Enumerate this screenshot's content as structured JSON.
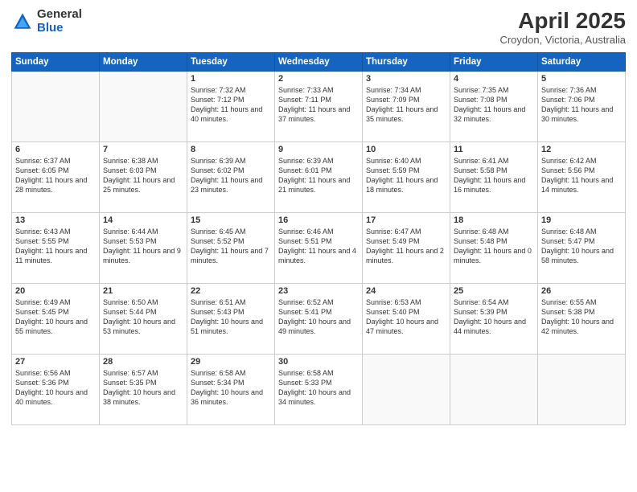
{
  "logo": {
    "general": "General",
    "blue": "Blue"
  },
  "title": {
    "month": "April 2025",
    "location": "Croydon, Victoria, Australia"
  },
  "weekdays": [
    "Sunday",
    "Monday",
    "Tuesday",
    "Wednesday",
    "Thursday",
    "Friday",
    "Saturday"
  ],
  "weeks": [
    [
      {
        "day": "",
        "info": ""
      },
      {
        "day": "",
        "info": ""
      },
      {
        "day": "1",
        "info": "Sunrise: 7:32 AM\nSunset: 7:12 PM\nDaylight: 11 hours and 40 minutes."
      },
      {
        "day": "2",
        "info": "Sunrise: 7:33 AM\nSunset: 7:11 PM\nDaylight: 11 hours and 37 minutes."
      },
      {
        "day": "3",
        "info": "Sunrise: 7:34 AM\nSunset: 7:09 PM\nDaylight: 11 hours and 35 minutes."
      },
      {
        "day": "4",
        "info": "Sunrise: 7:35 AM\nSunset: 7:08 PM\nDaylight: 11 hours and 32 minutes."
      },
      {
        "day": "5",
        "info": "Sunrise: 7:36 AM\nSunset: 7:06 PM\nDaylight: 11 hours and 30 minutes."
      }
    ],
    [
      {
        "day": "6",
        "info": "Sunrise: 6:37 AM\nSunset: 6:05 PM\nDaylight: 11 hours and 28 minutes."
      },
      {
        "day": "7",
        "info": "Sunrise: 6:38 AM\nSunset: 6:03 PM\nDaylight: 11 hours and 25 minutes."
      },
      {
        "day": "8",
        "info": "Sunrise: 6:39 AM\nSunset: 6:02 PM\nDaylight: 11 hours and 23 minutes."
      },
      {
        "day": "9",
        "info": "Sunrise: 6:39 AM\nSunset: 6:01 PM\nDaylight: 11 hours and 21 minutes."
      },
      {
        "day": "10",
        "info": "Sunrise: 6:40 AM\nSunset: 5:59 PM\nDaylight: 11 hours and 18 minutes."
      },
      {
        "day": "11",
        "info": "Sunrise: 6:41 AM\nSunset: 5:58 PM\nDaylight: 11 hours and 16 minutes."
      },
      {
        "day": "12",
        "info": "Sunrise: 6:42 AM\nSunset: 5:56 PM\nDaylight: 11 hours and 14 minutes."
      }
    ],
    [
      {
        "day": "13",
        "info": "Sunrise: 6:43 AM\nSunset: 5:55 PM\nDaylight: 11 hours and 11 minutes."
      },
      {
        "day": "14",
        "info": "Sunrise: 6:44 AM\nSunset: 5:53 PM\nDaylight: 11 hours and 9 minutes."
      },
      {
        "day": "15",
        "info": "Sunrise: 6:45 AM\nSunset: 5:52 PM\nDaylight: 11 hours and 7 minutes."
      },
      {
        "day": "16",
        "info": "Sunrise: 6:46 AM\nSunset: 5:51 PM\nDaylight: 11 hours and 4 minutes."
      },
      {
        "day": "17",
        "info": "Sunrise: 6:47 AM\nSunset: 5:49 PM\nDaylight: 11 hours and 2 minutes."
      },
      {
        "day": "18",
        "info": "Sunrise: 6:48 AM\nSunset: 5:48 PM\nDaylight: 11 hours and 0 minutes."
      },
      {
        "day": "19",
        "info": "Sunrise: 6:48 AM\nSunset: 5:47 PM\nDaylight: 10 hours and 58 minutes."
      }
    ],
    [
      {
        "day": "20",
        "info": "Sunrise: 6:49 AM\nSunset: 5:45 PM\nDaylight: 10 hours and 55 minutes."
      },
      {
        "day": "21",
        "info": "Sunrise: 6:50 AM\nSunset: 5:44 PM\nDaylight: 10 hours and 53 minutes."
      },
      {
        "day": "22",
        "info": "Sunrise: 6:51 AM\nSunset: 5:43 PM\nDaylight: 10 hours and 51 minutes."
      },
      {
        "day": "23",
        "info": "Sunrise: 6:52 AM\nSunset: 5:41 PM\nDaylight: 10 hours and 49 minutes."
      },
      {
        "day": "24",
        "info": "Sunrise: 6:53 AM\nSunset: 5:40 PM\nDaylight: 10 hours and 47 minutes."
      },
      {
        "day": "25",
        "info": "Sunrise: 6:54 AM\nSunset: 5:39 PM\nDaylight: 10 hours and 44 minutes."
      },
      {
        "day": "26",
        "info": "Sunrise: 6:55 AM\nSunset: 5:38 PM\nDaylight: 10 hours and 42 minutes."
      }
    ],
    [
      {
        "day": "27",
        "info": "Sunrise: 6:56 AM\nSunset: 5:36 PM\nDaylight: 10 hours and 40 minutes."
      },
      {
        "day": "28",
        "info": "Sunrise: 6:57 AM\nSunset: 5:35 PM\nDaylight: 10 hours and 38 minutes."
      },
      {
        "day": "29",
        "info": "Sunrise: 6:58 AM\nSunset: 5:34 PM\nDaylight: 10 hours and 36 minutes."
      },
      {
        "day": "30",
        "info": "Sunrise: 6:58 AM\nSunset: 5:33 PM\nDaylight: 10 hours and 34 minutes."
      },
      {
        "day": "",
        "info": ""
      },
      {
        "day": "",
        "info": ""
      },
      {
        "day": "",
        "info": ""
      }
    ]
  ]
}
